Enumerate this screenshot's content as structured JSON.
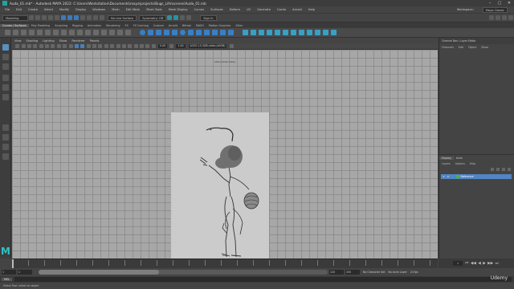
{
  "window": {
    "title": "Auda_01.mb* - Autodesk MAYA 2022: C:\\Users\\Workstation\\Documents\\maya\\projects\\Bugs_Life\\scenes\\Auda_01.mb",
    "controls": [
      "–",
      "▢",
      "✕"
    ]
  },
  "menubar": {
    "items": [
      "File",
      "Edit",
      "Create",
      "Select",
      "Modify",
      "Display",
      "Windows",
      "Mesh",
      "Edit Mesh",
      "Mesh Tools",
      "Mesh Display",
      "Curves",
      "Surfaces",
      "Deform",
      "UV",
      "Generate",
      "Cache",
      "Arnold",
      "Help"
    ],
    "workspace_label": "Workspace:",
    "workspace_value": "Maya Classic"
  },
  "statusline": {
    "mode": "Modeling",
    "no_live_surface": "No Live Surface",
    "symmetry": "Symmetry: Off",
    "sign_in": "Sign In"
  },
  "shelf": {
    "tabs": [
      "Curves / Surfaces",
      "Poly Modeling",
      "Sculpting",
      "Rigging",
      "Animation",
      "Rendering",
      "FX",
      "FX Caching",
      "Custom",
      "Arnold",
      "Bifrost",
      "MASH",
      "Motion Graphics",
      "XGen"
    ],
    "active_tab": 0
  },
  "panel": {
    "menus": [
      "View",
      "Shading",
      "Lighting",
      "Show",
      "Renderer",
      "Panels"
    ],
    "field_left": "0.00",
    "field_right": "1.00",
    "colorspace": "ACES 1.0 SDR-video (sRGB)"
  },
  "viewport": {
    "camera_label": "side1 (Side View)",
    "persp_label": "side"
  },
  "channelbox": {
    "tabs": [
      "Channel Box / Layer Editor",
      "Modeling Toolkit",
      "Attribute Editor"
    ],
    "menus": [
      "Channels",
      "Edit",
      "Object",
      "Show"
    ]
  },
  "layer_editor": {
    "tabs": [
      "Display",
      "Anim"
    ],
    "active_tab": 0,
    "menus": [
      "Layers",
      "Options",
      "Help"
    ],
    "layer": {
      "v": "V",
      "p": "P",
      "name": "Reference",
      "color": "#3fbb3f"
    }
  },
  "timeline": {
    "current_frame": "1",
    "playback_icons": [
      "⏮",
      "◀◀",
      "◀",
      "▶",
      "▶▶",
      "⏭"
    ]
  },
  "range": {
    "start": "1",
    "start_inner": "1",
    "end_inner": "120",
    "end": "120",
    "end2": "200",
    "char_set": "No Character Set",
    "anim_layer": "No Anim Layer",
    "fps": "24 fps"
  },
  "command": {
    "lang": "MEL"
  },
  "help_line": "Select Tool: select an object",
  "branding": {
    "maya_logo": "M",
    "watermark": "Udemy"
  }
}
